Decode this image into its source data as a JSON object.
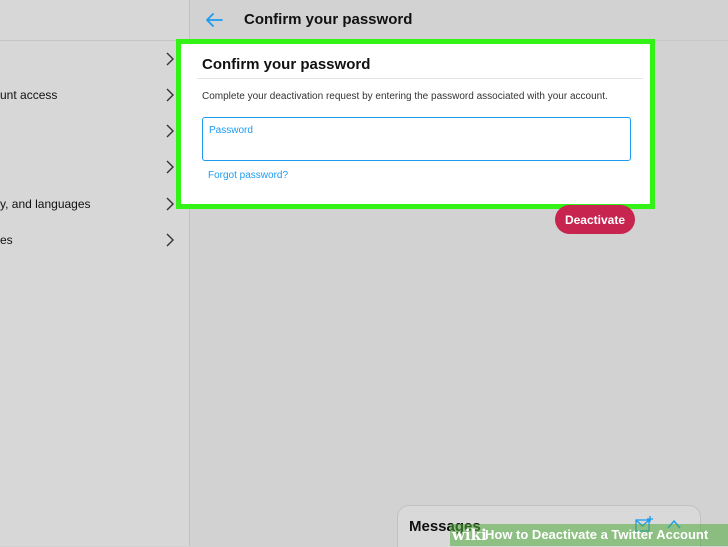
{
  "left_panel": {
    "items": [
      {
        "label": ""
      },
      {
        "label": "unt access"
      },
      {
        "label": ""
      },
      {
        "label": ""
      },
      {
        "label": "y, and languages"
      },
      {
        "label": "es"
      }
    ]
  },
  "header": {
    "title": "Confirm your password"
  },
  "card": {
    "title": "Confirm your password",
    "description": "Complete your deactivation request by entering the password associated with your account.",
    "password_label": "Password",
    "password_value": "",
    "forgot_link": "Forgot password?"
  },
  "deactivate_button": "Deactivate",
  "messages": {
    "title": "Messages"
  },
  "watermark": {
    "brand": "wiki",
    "text": "How to Deactivate a Twitter Account"
  },
  "colors": {
    "accent": "#1d9bf0",
    "deactivate": "#c7244f",
    "highlight": "#33f216"
  }
}
